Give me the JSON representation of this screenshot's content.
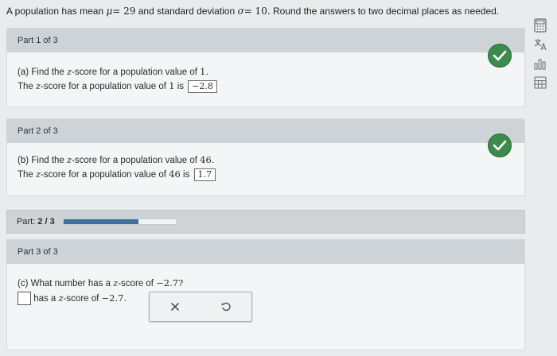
{
  "header": {
    "intro": "A population has mean",
    "mu_symbol": "μ",
    "mu_value": "= 29",
    "mid": " and standard deviation ",
    "sigma_symbol": "σ",
    "sigma_value": "= 10.",
    "tail": " Round the answers to two decimal places as needed."
  },
  "part1": {
    "heading": "Part 1 of 3",
    "q_pre": "(a) Find the ",
    "z": "z",
    "q_mid": "-score for a population value of ",
    "q_value": "1.",
    "a_pre": "The ",
    "a_mid": "-score for a population value of ",
    "a_value": "1",
    "a_is": " is ",
    "answer": "−2.8"
  },
  "part2": {
    "heading": "Part 2 of 3",
    "q_pre": "(b) Find the ",
    "q_mid": "-score for a population value of ",
    "q_value": "46.",
    "a_pre": "The ",
    "a_mid": "-score for a population value of ",
    "a_value": "46",
    "a_is": " is ",
    "answer": "1.7"
  },
  "progress": {
    "label": "Part:",
    "count": "2 / 3",
    "fraction": 0.667
  },
  "part3": {
    "heading": "Part 3 of 3",
    "q_pre": "(c) What number has a ",
    "q_mid": "-score of ",
    "q_value": "−2.7?",
    "a_text": " has a ",
    "a_mid": "-score of ",
    "a_value": "−2.7."
  },
  "colors": {
    "check_green": "#3c8a4c",
    "progress_blue": "#3f6f9d"
  }
}
